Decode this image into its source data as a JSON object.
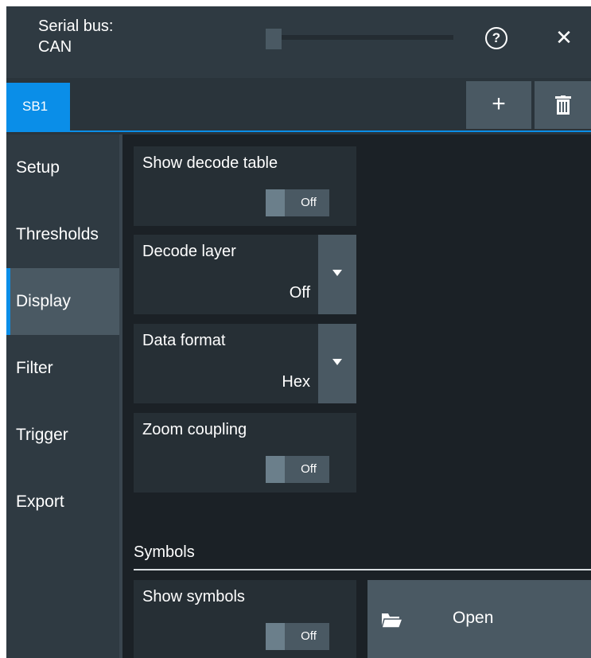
{
  "header": {
    "title_line1": "Serial bus:",
    "title_line2": "CAN",
    "help_symbol": "?",
    "close_symbol": "✕"
  },
  "tabs": {
    "items": [
      {
        "label": "SB1",
        "selected": true
      }
    ],
    "add_symbol": "+",
    "accent": "#0a8ee8"
  },
  "nav": {
    "items": [
      {
        "label": "Setup"
      },
      {
        "label": "Thresholds"
      },
      {
        "label": "Display",
        "active": true
      },
      {
        "label": "Filter"
      },
      {
        "label": "Trigger"
      },
      {
        "label": "Export"
      }
    ]
  },
  "settings": {
    "show_decode_table": {
      "label": "Show decode table",
      "state": "Off"
    },
    "decode_layer": {
      "label": "Decode layer",
      "value": "Off"
    },
    "data_format": {
      "label": "Data format",
      "value": "Hex"
    },
    "zoom_coupling": {
      "label": "Zoom coupling",
      "state": "Off"
    }
  },
  "symbols": {
    "section_title": "Symbols",
    "show_symbols": {
      "label": "Show symbols",
      "state": "Off"
    },
    "open_label": "Open"
  },
  "icons": {
    "help": "help-icon",
    "close": "close-icon",
    "add": "plus-icon",
    "delete": "trash-icon",
    "dropdown": "chevron-down-icon",
    "folder": "folder-open-icon"
  }
}
